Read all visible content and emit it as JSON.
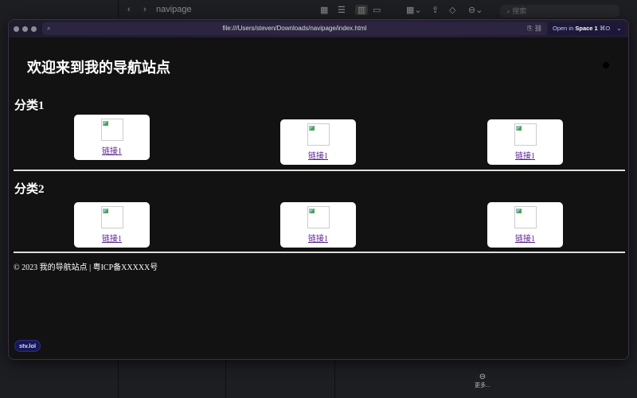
{
  "finder": {
    "folder": "navipage",
    "search_placeholder": "搜索",
    "more_label": "更多..."
  },
  "browser": {
    "url": "file:///Users/steven/Downloads/navipage/index.html",
    "open_in_prefix": "Open in",
    "open_in_space": "Space 1",
    "shortcut": "⌘O"
  },
  "page": {
    "title": "欢迎来到我的导航站点",
    "categories": [
      {
        "name": "分类1",
        "links": [
          {
            "label": "链接1"
          },
          {
            "label": "链接1"
          },
          {
            "label": "链接1"
          }
        ]
      },
      {
        "name": "分类2",
        "links": [
          {
            "label": "链接1"
          },
          {
            "label": "链接1"
          },
          {
            "label": "链接1"
          }
        ]
      }
    ],
    "footer": "© 2023 我的导航站点 | 粤ICP备XXXXX号",
    "badge": "stv.lol"
  }
}
